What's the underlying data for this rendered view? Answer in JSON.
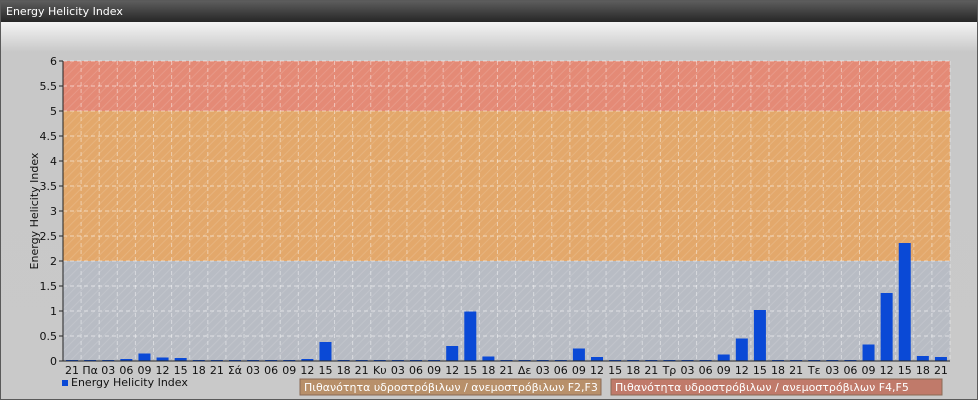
{
  "window": {
    "title": "Energy Helicity Index"
  },
  "chart_data": {
    "type": "bar",
    "title": "",
    "xlabel": "",
    "ylabel": "Energy Helicity Index",
    "ylim": [
      0,
      6
    ],
    "yticks": [
      "0",
      "0.5",
      "1",
      "1.5",
      "2",
      "2.5",
      "3",
      "3.5",
      "4",
      "4.5",
      "5",
      "5.5",
      "6"
    ],
    "grid": true,
    "legend_position": "bottom-left",
    "categories": [
      "21",
      "Πα",
      "03",
      "06",
      "09",
      "12",
      "15",
      "18",
      "21",
      "Σά",
      "03",
      "06",
      "09",
      "12",
      "15",
      "18",
      "21",
      "Κυ",
      "03",
      "06",
      "09",
      "12",
      "15",
      "18",
      "21",
      "Δε",
      "03",
      "06",
      "09",
      "12",
      "15",
      "18",
      "21",
      "Τρ",
      "03",
      "06",
      "09",
      "12",
      "15",
      "18",
      "21",
      "Τε",
      "03",
      "06",
      "09",
      "12",
      "15",
      "18",
      "21"
    ],
    "series": [
      {
        "name": "Energy Helicity Index",
        "color": "#0a49d6",
        "values": [
          0.02,
          0.02,
          0.02,
          0.04,
          0.15,
          0.07,
          0.06,
          0.02,
          0.02,
          0.02,
          0.02,
          0.02,
          0.02,
          0.04,
          0.38,
          0.02,
          0.02,
          0.02,
          0.02,
          0.02,
          0.02,
          0.3,
          0.99,
          0.09,
          0.02,
          0.02,
          0.02,
          0.02,
          0.25,
          0.08,
          0.02,
          0.02,
          0.02,
          0.02,
          0.02,
          0.02,
          0.13,
          0.45,
          1.02,
          0.02,
          0.02,
          0.02,
          0.02,
          0.02,
          0.33,
          1.36,
          2.36,
          0.1,
          0.08
        ]
      }
    ],
    "bands": [
      {
        "from": 0,
        "to": 2,
        "color": "#b8bcc4"
      },
      {
        "from": 2,
        "to": 5,
        "color": "#e3a86b"
      },
      {
        "from": 5,
        "to": 6,
        "color": "#e48a76"
      }
    ],
    "threshold_labels": [
      {
        "text": "Πιθανότητα υδροστρόβιλων / ανεμοστρόβιλων F2,F3",
        "color": "#b8906a"
      },
      {
        "text": "Πιθανότητα υδροστρόβιλων / ανεμοστρόβιλων F4,F5",
        "color": "#c07a6a"
      }
    ]
  }
}
